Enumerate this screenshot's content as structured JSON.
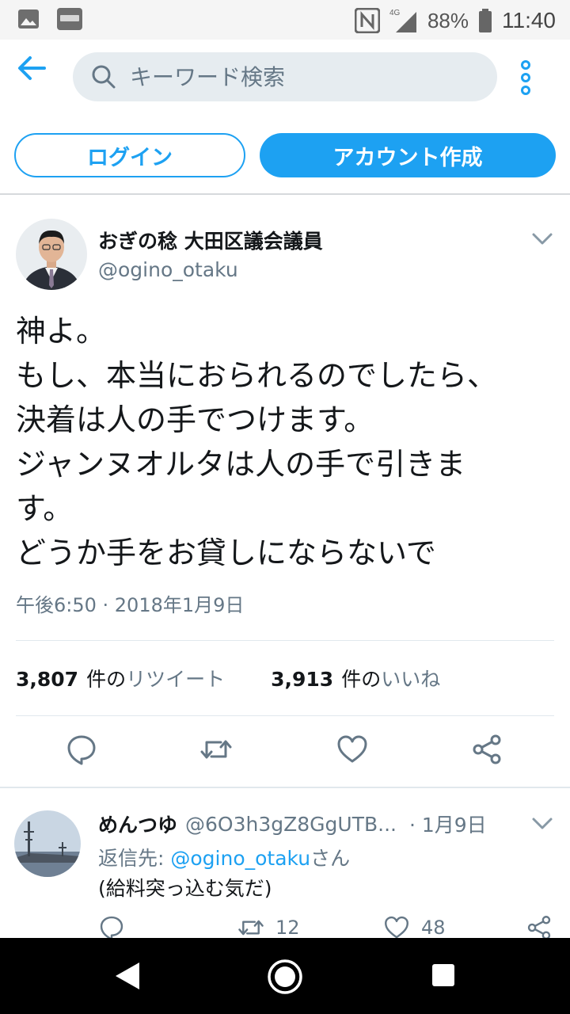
{
  "status_bar": {
    "battery": "88%",
    "time": "11:40",
    "network": "4G"
  },
  "search": {
    "placeholder": "キーワード検索"
  },
  "auth": {
    "login_label": "ログイン",
    "signup_label": "アカウント作成"
  },
  "tweet": {
    "author_name": "おぎの稔 大田区議会議員",
    "author_handle": "@ogino_otaku",
    "text_lines": [
      "神よ。",
      "もし、本当におられるのでしたら、",
      "決着は人の手でつけます。",
      "ジャンヌオルタは人の手で引きま",
      "す。",
      "どうか手をお貸しにならないで"
    ],
    "timestamp": "午後6:50 · 2018年1月9日",
    "retweets": {
      "count": "3,807",
      "unit": "件の",
      "label": "リツイート"
    },
    "likes": {
      "count": "3,913",
      "unit": "件の",
      "label": "いいね"
    }
  },
  "reply": {
    "name": "めんつゆ",
    "handle": "@6O3h3gZ8GgUTB...",
    "date": "· 1月9日",
    "reply_to_prefix": "返信先: ",
    "reply_to_handle": "@ogino_otaku",
    "reply_to_suffix": "さん",
    "text": "(給料突っ込む気だ)",
    "retweet_count": "12",
    "like_count": "48"
  },
  "colors": {
    "accent": "#1da1f2",
    "muted_text": "#657786",
    "text": "#14171a",
    "divider": "#e1e8ed"
  }
}
